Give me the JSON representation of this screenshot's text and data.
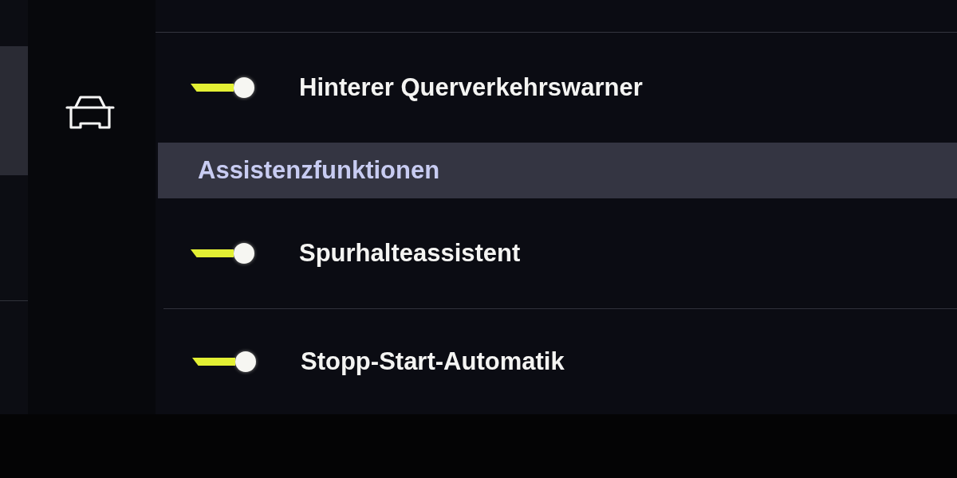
{
  "rows": [
    {
      "kind": "toggle",
      "label": "Hinterer Querverkehrswarner",
      "on": true
    },
    {
      "kind": "header",
      "label": "Assistenzfunktionen"
    },
    {
      "kind": "toggle",
      "label": "Spurhalteassistent",
      "on": true
    },
    {
      "kind": "toggle",
      "label": "Stopp-Start-Automatik",
      "on": true
    }
  ]
}
